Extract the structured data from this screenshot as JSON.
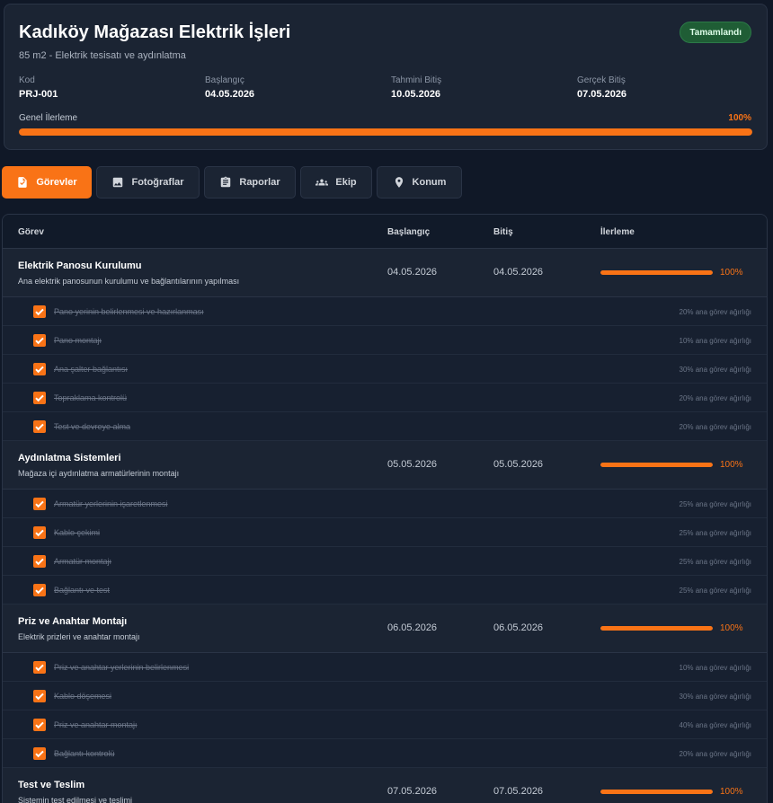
{
  "project": {
    "title": "Kadıköy Mağazası Elektrik İşleri",
    "subtitle": "85 m2 - Elektrik tesisatı ve aydınlatma",
    "status": "Tamamlandı",
    "meta": [
      {
        "label": "Kod",
        "value": "PRJ-001"
      },
      {
        "label": "Başlangıç",
        "value": "04.05.2026"
      },
      {
        "label": "Tahmini Bitiş",
        "value": "10.05.2026"
      },
      {
        "label": "Gerçek Bitiş",
        "value": "07.05.2026"
      }
    ],
    "progress_label": "Genel İlerleme",
    "progress_text": "100%",
    "progress_value": 100
  },
  "tabs": [
    {
      "label": "Görevler",
      "icon": "task-document-icon",
      "active": true
    },
    {
      "label": "Fotoğraflar",
      "icon": "image-icon",
      "active": false
    },
    {
      "label": "Raporlar",
      "icon": "clipboard-icon",
      "active": false
    },
    {
      "label": "Ekip",
      "icon": "people-icon",
      "active": false
    },
    {
      "label": "Konum",
      "icon": "location-pin-icon",
      "active": false
    }
  ],
  "table": {
    "headers": [
      "Görev",
      "Başlangıç",
      "Bitiş",
      "İlerleme"
    ],
    "tasks": [
      {
        "name": "Elektrik Panosu Kurulumu",
        "description": "Ana elektrik panosunun kurulumu ve bağlantılarının yapılması",
        "start": "04.05.2026",
        "end": "04.05.2026",
        "progress_text": "100%",
        "progress": 100,
        "subtasks": [
          {
            "name": "Pano yerinin belirlenmesi ve hazırlanması",
            "weight": "20% ana görev ağırlığı",
            "done": true
          },
          {
            "name": "Pano montajı",
            "weight": "10% ana görev ağırlığı",
            "done": true
          },
          {
            "name": "Ana şalter bağlantısı",
            "weight": "30% ana görev ağırlığı",
            "done": true
          },
          {
            "name": "Topraklama kontrolü",
            "weight": "20% ana görev ağırlığı",
            "done": true
          },
          {
            "name": "Test ve devreye alma",
            "weight": "20% ana görev ağırlığı",
            "done": true
          }
        ]
      },
      {
        "name": "Aydınlatma Sistemleri",
        "description": "Mağaza içi aydınlatma armatürlerinin montajı",
        "start": "05.05.2026",
        "end": "05.05.2026",
        "progress_text": "100%",
        "progress": 100,
        "subtasks": [
          {
            "name": "Armatür yerlerinin işaretlenmesi",
            "weight": "25% ana görev ağırlığı",
            "done": true
          },
          {
            "name": "Kablo çekimi",
            "weight": "25% ana görev ağırlığı",
            "done": true
          },
          {
            "name": "Armatür montajı",
            "weight": "25% ana görev ağırlığı",
            "done": true
          },
          {
            "name": "Bağlantı ve test",
            "weight": "25% ana görev ağırlığı",
            "done": true
          }
        ]
      },
      {
        "name": "Priz ve Anahtar Montajı",
        "description": "Elektrik prizleri ve anahtar montajı",
        "start": "06.05.2026",
        "end": "06.05.2026",
        "progress_text": "100%",
        "progress": 100,
        "subtasks": [
          {
            "name": "Priz ve anahtar yerlerinin belirlenmesi",
            "weight": "10% ana görev ağırlığı",
            "done": true
          },
          {
            "name": "Kablo döşemesi",
            "weight": "30% ana görev ağırlığı",
            "done": true
          },
          {
            "name": "Priz ve anahtar montajı",
            "weight": "40% ana görev ağırlığı",
            "done": true
          },
          {
            "name": "Bağlantı kontrolü",
            "weight": "20% ana görev ağırlığı",
            "done": true
          }
        ]
      },
      {
        "name": "Test ve Teslim",
        "description": "Sistemin test edilmesi ve teslimi",
        "start": "07.05.2026",
        "end": "07.05.2026",
        "progress_text": "100%",
        "progress": 100,
        "subtasks": []
      }
    ]
  },
  "colors": {
    "accent": "#f97316",
    "success": "#1f5d35",
    "background": "#101827"
  }
}
